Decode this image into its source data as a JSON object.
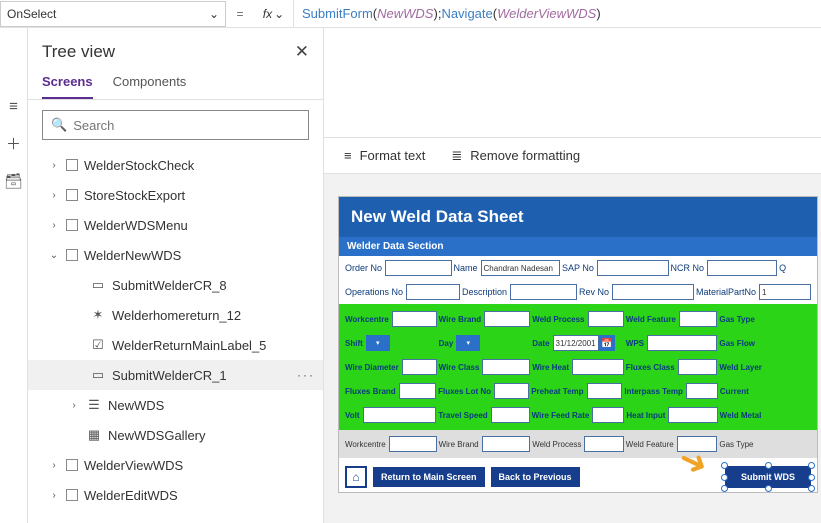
{
  "property_selector": "OnSelect",
  "formula": {
    "fn1": "SubmitForm",
    "arg1": "NewWDS",
    "fn2": "Navigate",
    "arg2": "WelderViewWDS"
  },
  "tree": {
    "title": "Tree view",
    "tabs": {
      "screens": "Screens",
      "components": "Components"
    },
    "search_placeholder": "Search",
    "items": {
      "stockcheck": "WelderStockCheck",
      "stockexport": "StoreStockExport",
      "wdsmenu": "WelderWDSMenu",
      "newwds": "WelderNewWDS",
      "submitcr8": "SubmitWelderCR_8",
      "homereturn": "Welderhomereturn_12",
      "returnmain": "WelderReturnMainLabel_5",
      "submitcr1": "SubmitWelderCR_1",
      "newwds_child": "NewWDS",
      "gallery": "NewWDSGallery",
      "viewwds": "WelderViewWDS",
      "editwds": "WelderEditWDS"
    }
  },
  "toolbar": {
    "format": "Format text",
    "remove": "Remove formatting"
  },
  "screen": {
    "title": "New Weld Data Sheet",
    "section": "Welder Data Section",
    "labels": {
      "order": "Order No",
      "name": "Name",
      "namev": "Chandran Nadesan",
      "sap": "SAP No",
      "ncr": "NCR No",
      "q": "Q",
      "ops": "Operations No",
      "desc": "Description",
      "rev": "Rev No",
      "mat": "MaterialPartNo",
      "matv": "1",
      "wc": "Workcentre",
      "wb": "Wire Brand",
      "wp": "Weld Process",
      "wf": "Weld Feature",
      "gt": "Gas Type",
      "shift": "Shift",
      "day": "Day",
      "date": "Date",
      "datev": "31/12/2001",
      "wps": "WPS",
      "gf": "Gas Flow",
      "wd": "Wire Diameter",
      "wcls": "Wire Class",
      "wh": "Wire Heat",
      "fc": "Fluxes Class",
      "wl": "Weld Layer",
      "fb": "Fluxes Brand",
      "fl": "Fluxes Lot No",
      "pt": "Preheat Temp",
      "it": "Interpass Temp",
      "cur": "Current",
      "volt": "Volt",
      "ts": "Travel Speed",
      "wfr": "Wire Feed Rate",
      "hi": "Heat Input",
      "wm": "Weld Metal"
    },
    "buttons": {
      "main": "Return to Main Screen",
      "back": "Back to Previous",
      "submit": "Submit WDS"
    }
  }
}
